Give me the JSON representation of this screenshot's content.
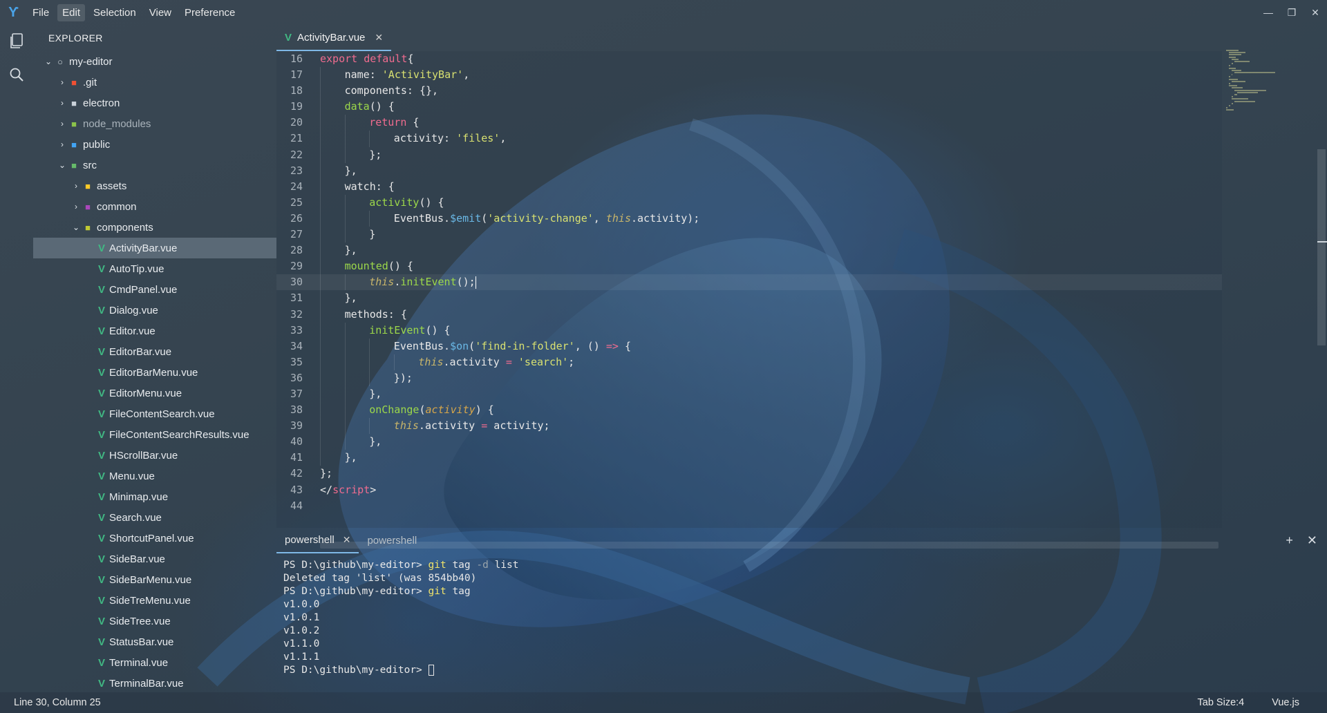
{
  "menubar": {
    "items": [
      "File",
      "Edit",
      "Selection",
      "View",
      "Preference"
    ],
    "active_index": 1
  },
  "window_controls": [
    "minimize-icon",
    "restore-icon",
    "close-icon"
  ],
  "activity_bar": [
    "files-icon",
    "search-icon"
  ],
  "sidebar": {
    "title": "EXPLORER",
    "tree": [
      {
        "label": "my-editor",
        "depth": 0,
        "chevron": "down",
        "icon": "root-circle-icon",
        "icon_color": "#cfd6dc"
      },
      {
        "label": ".git",
        "depth": 1,
        "chevron": "right",
        "icon": "folder-icon",
        "icon_color": "#f05033"
      },
      {
        "label": "electron",
        "depth": 1,
        "chevron": "right",
        "icon": "folder-icon",
        "icon_color": "#c9d1d9"
      },
      {
        "label": "node_modules",
        "depth": 1,
        "chevron": "right",
        "icon": "folder-icon",
        "icon_color": "#8bc34a",
        "dim": true
      },
      {
        "label": "public",
        "depth": 1,
        "chevron": "right",
        "icon": "folder-icon",
        "icon_color": "#42a5f5"
      },
      {
        "label": "src",
        "depth": 1,
        "chevron": "down",
        "icon": "folder-icon",
        "icon_color": "#66bb6a"
      },
      {
        "label": "assets",
        "depth": 2,
        "chevron": "right",
        "icon": "folder-icon",
        "icon_color": "#ffca28"
      },
      {
        "label": "common",
        "depth": 2,
        "chevron": "right",
        "icon": "folder-icon",
        "icon_color": "#ab47bc"
      },
      {
        "label": "components",
        "depth": 2,
        "chevron": "down",
        "icon": "folder-icon",
        "icon_color": "#c0ca33"
      },
      {
        "label": "ActivityBar.vue",
        "depth": 3,
        "icon": "vue-icon",
        "selected": true
      },
      {
        "label": "AutoTip.vue",
        "depth": 3,
        "icon": "vue-icon"
      },
      {
        "label": "CmdPanel.vue",
        "depth": 3,
        "icon": "vue-icon"
      },
      {
        "label": "Dialog.vue",
        "depth": 3,
        "icon": "vue-icon"
      },
      {
        "label": "Editor.vue",
        "depth": 3,
        "icon": "vue-icon"
      },
      {
        "label": "EditorBar.vue",
        "depth": 3,
        "icon": "vue-icon"
      },
      {
        "label": "EditorBarMenu.vue",
        "depth": 3,
        "icon": "vue-icon"
      },
      {
        "label": "EditorMenu.vue",
        "depth": 3,
        "icon": "vue-icon"
      },
      {
        "label": "FileContentSearch.vue",
        "depth": 3,
        "icon": "vue-icon"
      },
      {
        "label": "FileContentSearchResults.vue",
        "depth": 3,
        "icon": "vue-icon"
      },
      {
        "label": "HScrollBar.vue",
        "depth": 3,
        "icon": "vue-icon"
      },
      {
        "label": "Menu.vue",
        "depth": 3,
        "icon": "vue-icon"
      },
      {
        "label": "Minimap.vue",
        "depth": 3,
        "icon": "vue-icon"
      },
      {
        "label": "Search.vue",
        "depth": 3,
        "icon": "vue-icon"
      },
      {
        "label": "ShortcutPanel.vue",
        "depth": 3,
        "icon": "vue-icon"
      },
      {
        "label": "SideBar.vue",
        "depth": 3,
        "icon": "vue-icon"
      },
      {
        "label": "SideBarMenu.vue",
        "depth": 3,
        "icon": "vue-icon"
      },
      {
        "label": "SideTreMenu.vue",
        "depth": 3,
        "icon": "vue-icon"
      },
      {
        "label": "SideTree.vue",
        "depth": 3,
        "icon": "vue-icon"
      },
      {
        "label": "StatusBar.vue",
        "depth": 3,
        "icon": "vue-icon"
      },
      {
        "label": "Terminal.vue",
        "depth": 3,
        "icon": "vue-icon"
      },
      {
        "label": "TerminalBar.vue",
        "depth": 3,
        "icon": "vue-icon"
      }
    ]
  },
  "editor": {
    "tab": {
      "label": "ActivityBar.vue",
      "icon": "vue-icon"
    },
    "current_line": 30,
    "lines": [
      {
        "n": "16",
        "indent": 0,
        "tokens": [
          [
            "kw",
            "export default"
          ],
          [
            "",
            "{"
          ]
        ]
      },
      {
        "n": "17",
        "indent": 1,
        "tokens": [
          [
            "",
            "name: "
          ],
          [
            "str",
            "'ActivityBar'"
          ],
          [
            "",
            ","
          ]
        ]
      },
      {
        "n": "18",
        "indent": 1,
        "tokens": [
          [
            "",
            "components: {},"
          ]
        ]
      },
      {
        "n": "19",
        "indent": 1,
        "tokens": [
          [
            "fn",
            "data"
          ],
          [
            "",
            "() {"
          ]
        ]
      },
      {
        "n": "20",
        "indent": 2,
        "tokens": [
          [
            "kw",
            "return"
          ],
          [
            "",
            " {"
          ]
        ]
      },
      {
        "n": "21",
        "indent": 3,
        "tokens": [
          [
            "",
            "activity: "
          ],
          [
            "str",
            "'files'"
          ],
          [
            "",
            ","
          ]
        ]
      },
      {
        "n": "22",
        "indent": 2,
        "tokens": [
          [
            "",
            "};"
          ]
        ]
      },
      {
        "n": "23",
        "indent": 1,
        "tokens": [
          [
            "",
            "},"
          ]
        ]
      },
      {
        "n": "24",
        "indent": 1,
        "tokens": [
          [
            "",
            "watch: {"
          ]
        ]
      },
      {
        "n": "25",
        "indent": 2,
        "tokens": [
          [
            "fn",
            "activity"
          ],
          [
            "",
            "() {"
          ]
        ]
      },
      {
        "n": "26",
        "indent": 3,
        "tokens": [
          [
            "",
            "EventBus."
          ],
          [
            "em",
            "$emit"
          ],
          [
            "",
            "("
          ],
          [
            "str",
            "'activity-change'"
          ],
          [
            "",
            ", "
          ],
          [
            "this",
            "this"
          ],
          [
            "",
            ".activity);"
          ]
        ]
      },
      {
        "n": "27",
        "indent": 2,
        "tokens": [
          [
            "",
            "}"
          ]
        ]
      },
      {
        "n": "28",
        "indent": 1,
        "tokens": [
          [
            "",
            "},"
          ]
        ]
      },
      {
        "n": "29",
        "indent": 1,
        "tokens": [
          [
            "fn",
            "mounted"
          ],
          [
            "",
            "() {"
          ]
        ]
      },
      {
        "n": "30",
        "indent": 2,
        "tokens": [
          [
            "this",
            "this"
          ],
          [
            "",
            "."
          ],
          [
            "fn",
            "initEvent"
          ],
          [
            "",
            "();"
          ]
        ],
        "cursor": true
      },
      {
        "n": "31",
        "indent": 1,
        "tokens": [
          [
            "",
            "},"
          ]
        ]
      },
      {
        "n": "32",
        "indent": 1,
        "tokens": [
          [
            "",
            "methods: {"
          ]
        ]
      },
      {
        "n": "33",
        "indent": 2,
        "tokens": [
          [
            "fn",
            "initEvent"
          ],
          [
            "",
            "() {"
          ]
        ]
      },
      {
        "n": "34",
        "indent": 3,
        "tokens": [
          [
            "",
            "EventBus."
          ],
          [
            "em",
            "$on"
          ],
          [
            "",
            "("
          ],
          [
            "str",
            "'find-in-folder'"
          ],
          [
            "",
            ", () "
          ],
          [
            "kw",
            "=>"
          ],
          [
            "",
            " {"
          ]
        ]
      },
      {
        "n": "35",
        "indent": 4,
        "tokens": [
          [
            "this",
            "this"
          ],
          [
            "",
            ".activity "
          ],
          [
            "kw",
            "="
          ],
          [
            "",
            " "
          ],
          [
            "str",
            "'search'"
          ],
          [
            "",
            ";"
          ]
        ]
      },
      {
        "n": "36",
        "indent": 3,
        "tokens": [
          [
            "",
            "});"
          ]
        ]
      },
      {
        "n": "37",
        "indent": 2,
        "tokens": [
          [
            "",
            "},"
          ]
        ]
      },
      {
        "n": "38",
        "indent": 2,
        "tokens": [
          [
            "fn",
            "onChange"
          ],
          [
            "",
            "("
          ],
          [
            "param",
            "activity"
          ],
          [
            "",
            ") {"
          ]
        ]
      },
      {
        "n": "39",
        "indent": 3,
        "tokens": [
          [
            "this",
            "this"
          ],
          [
            "",
            ".activity "
          ],
          [
            "kw",
            "="
          ],
          [
            "",
            " activity;"
          ]
        ]
      },
      {
        "n": "40",
        "indent": 2,
        "tokens": [
          [
            "",
            "},"
          ]
        ]
      },
      {
        "n": "41",
        "indent": 1,
        "tokens": [
          [
            "",
            "},"
          ]
        ]
      },
      {
        "n": "42",
        "indent": 0,
        "tokens": [
          [
            "",
            "};"
          ]
        ]
      },
      {
        "n": "43",
        "indent": 0,
        "tokens": [
          [
            "",
            "</"
          ],
          [
            "kw",
            "script"
          ],
          [
            "",
            ">"
          ]
        ]
      },
      {
        "n": "44",
        "indent": 0,
        "tokens": []
      }
    ]
  },
  "terminal": {
    "tabs": [
      {
        "label": "powershell",
        "active": true
      },
      {
        "label": "powershell",
        "active": false
      }
    ],
    "lines": [
      [
        [
          "",
          "PS D:\\github\\my-editor> "
        ],
        [
          "cmd",
          "git"
        ],
        [
          "",
          " tag "
        ],
        [
          "flag",
          "-d"
        ],
        [
          "",
          " list"
        ]
      ],
      [
        [
          "",
          "Deleted tag 'list' (was 854bb40)"
        ]
      ],
      [
        [
          "",
          "PS D:\\github\\my-editor> "
        ],
        [
          "cmd",
          "git"
        ],
        [
          "",
          " tag"
        ]
      ],
      [
        [
          "",
          "v1.0.0"
        ]
      ],
      [
        [
          "",
          "v1.0.1"
        ]
      ],
      [
        [
          "",
          "v1.0.2"
        ]
      ],
      [
        [
          "",
          "v1.1.0"
        ]
      ],
      [
        [
          "",
          "v1.1.1"
        ]
      ],
      [
        [
          "",
          "PS D:\\github\\my-editor> "
        ],
        [
          "cursor",
          ""
        ]
      ]
    ]
  },
  "statusbar": {
    "position": "Line 30, Column 25",
    "tab_size": "Tab Size:4",
    "language": "Vue.js"
  }
}
